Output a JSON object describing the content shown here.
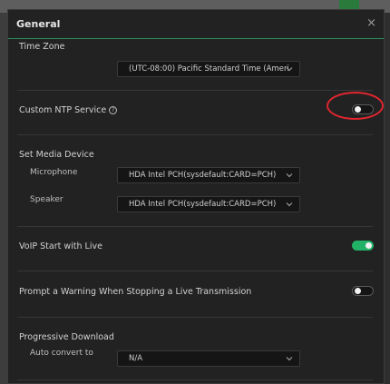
{
  "dialog": {
    "title": "General",
    "close_glyph": "×"
  },
  "time_zone": {
    "label": "Time Zone",
    "value": "(UTC-08:00) Pacific Standard Time (Americ"
  },
  "ntp": {
    "label": "Custom NTP Service",
    "help_glyph": "?",
    "enabled": false
  },
  "media_device": {
    "label": "Set Media Device",
    "microphone_label": "Microphone",
    "microphone_value": "HDA Intel PCH(sysdefault:CARD=PCH)",
    "speaker_label": "Speaker",
    "speaker_value": "HDA Intel PCH(sysdefault:CARD=PCH)"
  },
  "voip": {
    "label": "VoIP Start with Live",
    "enabled": true
  },
  "warning": {
    "label": "Prompt a Warning When Stopping a Live Transmission",
    "enabled": false
  },
  "progressive": {
    "label": "Progressive Download",
    "auto_convert_label": "Auto convert to",
    "auto_convert_value": "N/A"
  },
  "colors": {
    "accent": "#22b267",
    "annotation": "#e0262e",
    "background": "#222222"
  },
  "icons": {
    "close": "close-icon",
    "help": "help-circle-icon",
    "chevron": "chevron-down-icon"
  }
}
